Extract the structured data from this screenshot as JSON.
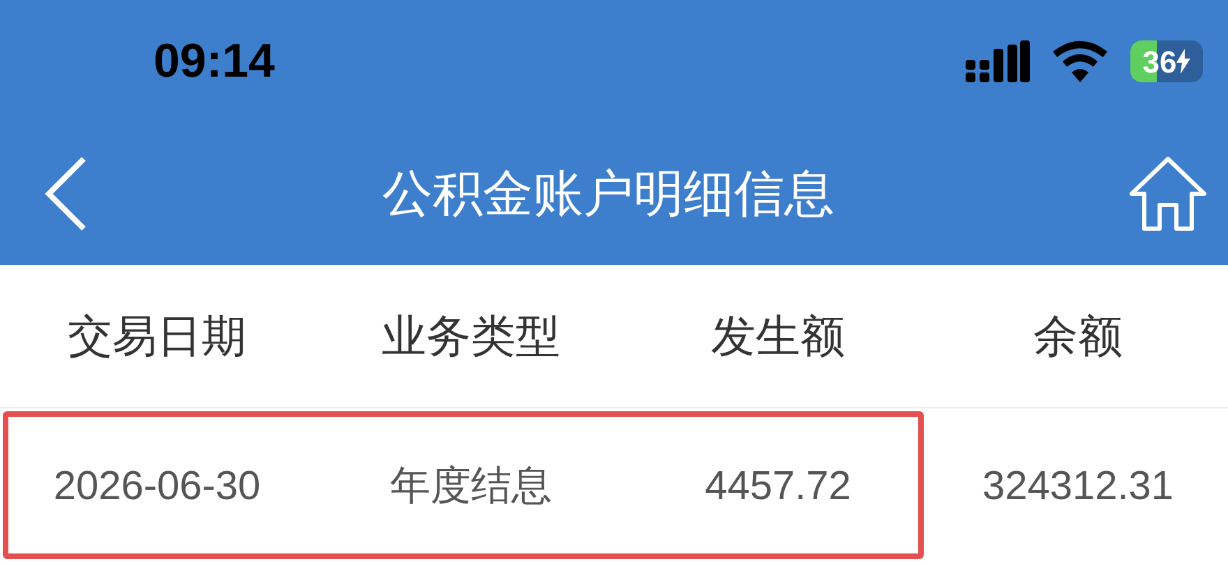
{
  "status_bar": {
    "time": "09:14",
    "battery": "36"
  },
  "nav_bar": {
    "title": "公积金账户明细信息"
  },
  "table": {
    "columns": [
      "交易日期",
      "业务类型",
      "发生额",
      "余额"
    ],
    "rows": [
      {
        "cells": [
          "2026-06-30",
          "年度结息",
          "4457.72",
          "324312.31"
        ],
        "highlighted": true
      }
    ]
  }
}
